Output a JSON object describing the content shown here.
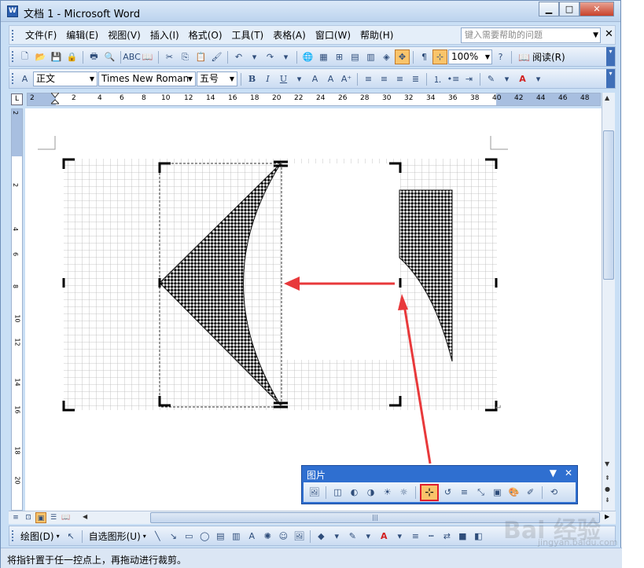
{
  "window": {
    "title": "文档 1 - Microsoft Word",
    "app_icon_letter": "W"
  },
  "menubar": {
    "items": [
      "文件(F)",
      "编辑(E)",
      "视图(V)",
      "插入(I)",
      "格式(O)",
      "工具(T)",
      "表格(A)",
      "窗口(W)",
      "帮助(H)"
    ],
    "help_placeholder": "键入需要帮助的问题"
  },
  "standard_toolbar": {
    "zoom": "100%",
    "read_label": "阅读(R)"
  },
  "formatting_toolbar": {
    "style": "正文",
    "font": "Times New Roman",
    "size": "五号"
  },
  "ruler": {
    "horizontal_ticks": [
      "2",
      "2",
      "4",
      "6",
      "8",
      "10",
      "12",
      "14",
      "16",
      "18",
      "20",
      "22",
      "24",
      "26",
      "28",
      "30",
      "32",
      "34",
      "36",
      "38",
      "40",
      "42",
      "44",
      "46",
      "48"
    ],
    "vertical_ticks": [
      "2",
      "2",
      "4",
      "6",
      "8",
      "10",
      "12",
      "14",
      "16",
      "18",
      "20"
    ]
  },
  "picture_toolbar": {
    "title": "图片"
  },
  "drawing_toolbar": {
    "draw_label": "绘图(D)",
    "autoshapes_label": "自选图形(U)"
  },
  "status": {
    "message": "将指针置于任一控点上，再拖动进行裁剪。"
  },
  "colors": {
    "accent_orange": "#f9c46a",
    "highlight_red": "#e01e2e",
    "arrow_red": "#e8393b",
    "picture_toolbar_blue": "#2f6fd0"
  },
  "watermark": {
    "brand": "Bai 经验",
    "url": "jingyan.baidu.com"
  }
}
